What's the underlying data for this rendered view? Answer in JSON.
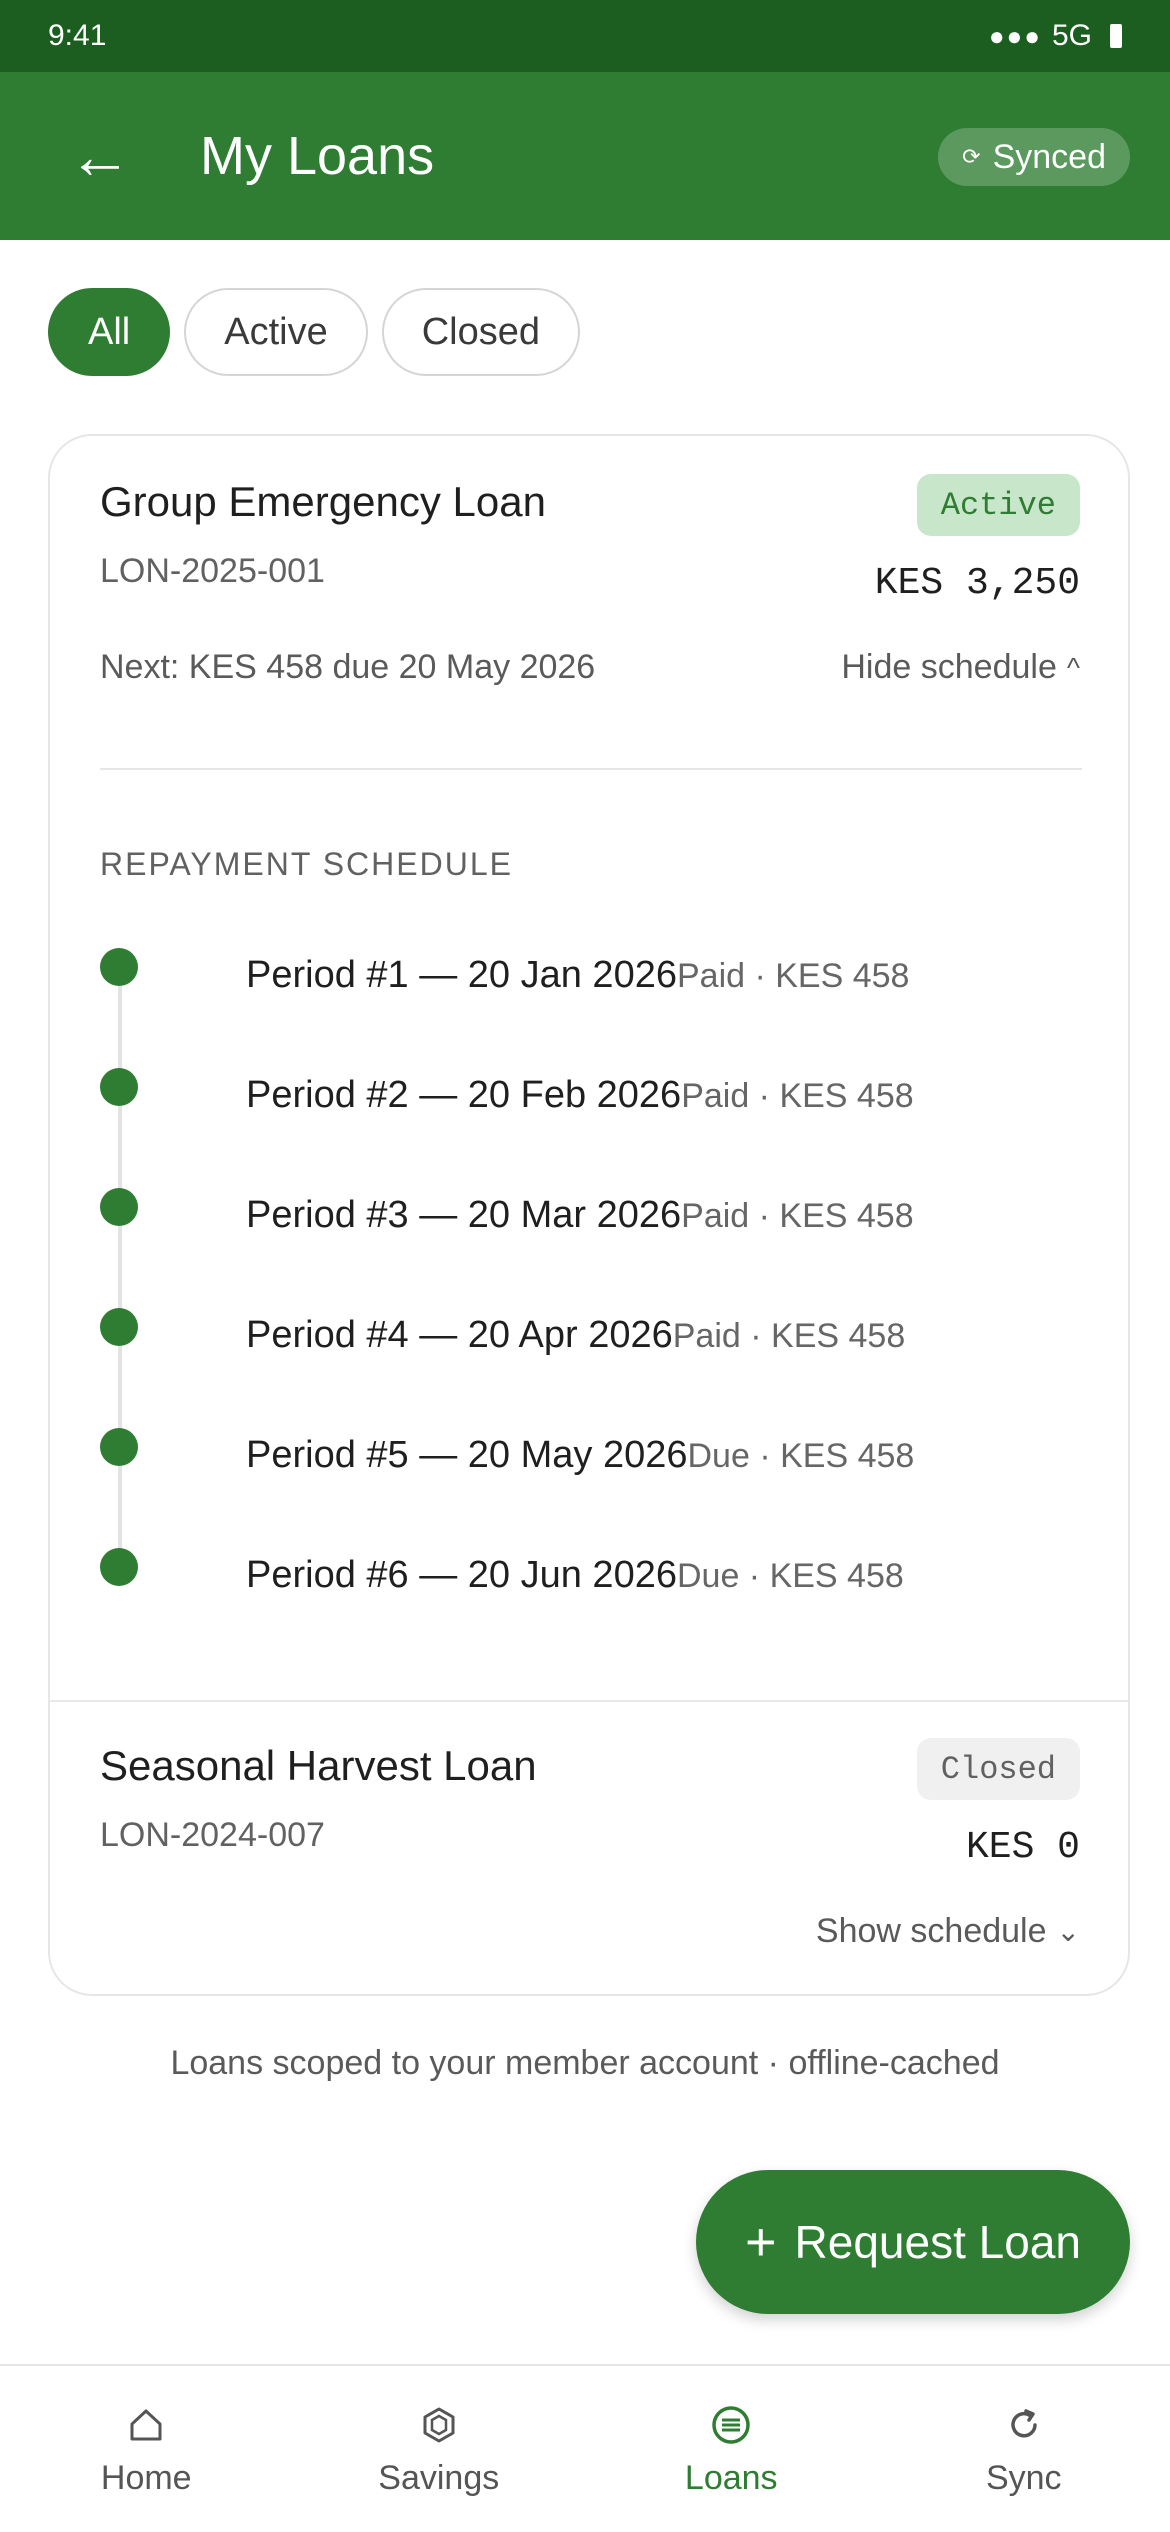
{
  "status_bar": {
    "time": "9:41",
    "signal": "●●●",
    "network": "5G"
  },
  "app_bar": {
    "title": "My Loans",
    "sync_label": "Synced",
    "sync_icon": "⟳"
  },
  "filters": [
    {
      "label": "All",
      "selected": true
    },
    {
      "label": "Active",
      "selected": false
    },
    {
      "label": "Closed",
      "selected": false
    }
  ],
  "loans": [
    {
      "name": "Group Emergency Loan",
      "id": "LON-2025-001",
      "status": "Active",
      "amount": "KES 3,250",
      "next_due": "Next: KES 458 due 20 May 2026",
      "toggle_label": "Hide schedule",
      "toggle_icon": "^",
      "schedule_title": "REPAYMENT SCHEDULE",
      "schedule": [
        {
          "period": "Period #1 — 20 Jan 2026",
          "status": "Paid · KES 458"
        },
        {
          "period": "Period #2 — 20 Feb 2026",
          "status": "Paid · KES 458"
        },
        {
          "period": "Period #3 — 20 Mar 2026",
          "status": "Paid · KES 458"
        },
        {
          "period": "Period #4 — 20 Apr 2026",
          "status": "Paid · KES 458"
        },
        {
          "period": "Period #5 — 20 May 2026",
          "status": "Due · KES 458"
        },
        {
          "period": "Period #6 — 20 Jun 2026",
          "status": "Due · KES 458"
        }
      ]
    },
    {
      "name": "Seasonal Harvest Loan",
      "id": "LON-2024-007",
      "status": "Closed",
      "amount": "KES 0",
      "toggle_label": "Show schedule",
      "toggle_icon": "⌄"
    }
  ],
  "footer_note": "Loans scoped to your member account · offline-cached",
  "fab": {
    "label": "Request Loan",
    "icon": "+"
  },
  "bottom_nav": [
    {
      "label": "Home",
      "icon": "home-icon",
      "selected": false
    },
    {
      "label": "Savings",
      "icon": "savings-icon",
      "selected": false
    },
    {
      "label": "Loans",
      "icon": "loans-icon",
      "selected": true
    },
    {
      "label": "Sync",
      "icon": "sync-icon",
      "selected": false
    }
  ],
  "colors": {
    "primary": "#2e7d32",
    "status_bar": "#1c5e20",
    "active_badge_bg": "#c8e6c9"
  }
}
